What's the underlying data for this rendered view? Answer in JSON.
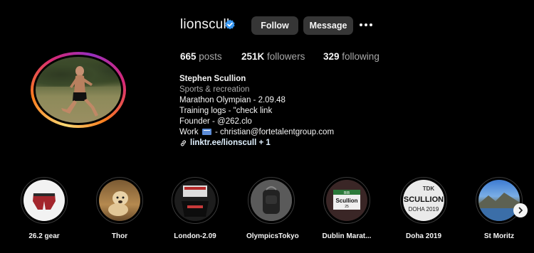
{
  "profile": {
    "username": "lionscull",
    "verified": true,
    "follow_label": "Follow",
    "message_label": "Message",
    "stats": {
      "posts_count": "665",
      "posts_label": "posts",
      "followers_count": "251K",
      "followers_label": "followers",
      "following_count": "329",
      "following_label": "following"
    },
    "bio": {
      "name": "Stephen Scullion",
      "category": "Sports & recreation",
      "line1": "Marathon Olympian - 2.09.48",
      "line2": "Training logs - \"check link",
      "line3": "Founder - @262.clo",
      "line4_prefix": "Work",
      "line4_suffix": "- christian@fortetalentgroup.com",
      "link": "linktr.ee/lionscull + 1"
    }
  },
  "highlights": [
    {
      "label": "26.2 gear"
    },
    {
      "label": "Thor"
    },
    {
      "label": "London-2.09"
    },
    {
      "label": "OlympicsTokyo"
    },
    {
      "label": "Dublin Marat..."
    },
    {
      "label": "Doha 2019"
    },
    {
      "label": "St Moritz"
    }
  ],
  "highlight_texts": {
    "dublin_top": "BIB",
    "dublin_name": "Scullion",
    "dublin_num": "25",
    "doha_brand": "TDK",
    "doha_name": "SCULLION",
    "doha_event": "DOHA 2019"
  },
  "colors": {
    "verified": "#3897f0",
    "button_bg": "#363636",
    "secondary_text": "#a8a8a8"
  },
  "icons": {
    "verified": "verified-badge-icon",
    "more": "more-horizontal-icon",
    "link": "link-icon",
    "work": "email-emoji-icon",
    "next": "chevron-right-icon"
  }
}
